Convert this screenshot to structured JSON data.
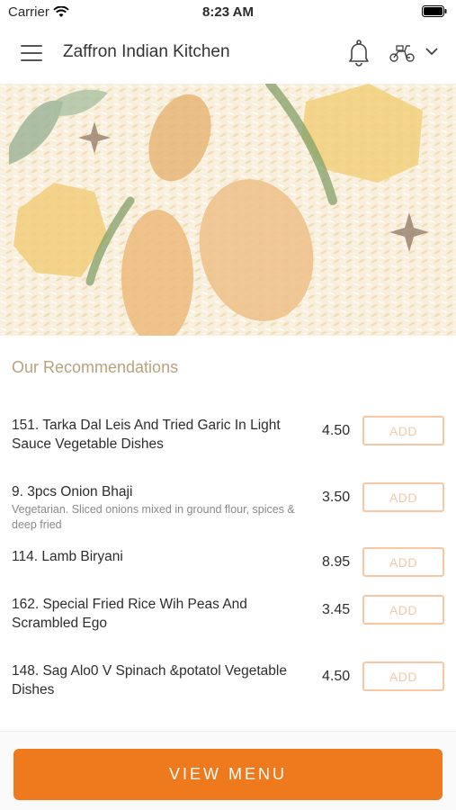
{
  "status_bar": {
    "carrier": "Carrier",
    "time": "8:23 AM"
  },
  "header": {
    "title": "Zaffron Indian Kitchen",
    "icons": [
      "menu-icon",
      "bell-icon",
      "scooter-icon",
      "chevron-down-icon"
    ]
  },
  "section": {
    "title": "Our Recommendations"
  },
  "items": [
    {
      "name": "151. Tarka Dal Leis And Tried Garic In Light Sauce Vegetable Dishes",
      "desc": "",
      "price": "4.50",
      "add": "ADD"
    },
    {
      "name": "9. 3pcs Onion Bhaji",
      "desc": "Vegetarian. Sliced onions mixed in ground flour, spices & deep fried",
      "price": "3.50",
      "add": "ADD"
    },
    {
      "name": "114. Lamb Biryani",
      "desc": "",
      "price": "8.95",
      "add": "ADD"
    },
    {
      "name": "162. Special Fried Rice Wih Peas And Scrambled Ego",
      "desc": "",
      "price": "3.45",
      "add": "ADD"
    },
    {
      "name": "148. Sag Alo0 V Spinach &potatol Vegetable Dishes",
      "desc": "",
      "price": "4.50",
      "add": "ADD"
    }
  ],
  "footer": {
    "button_label": "VIEW MENU"
  },
  "colors": {
    "accent": "#ef7a1e",
    "add_border": "#f6c7a0",
    "section_title": "#b8a27c"
  }
}
